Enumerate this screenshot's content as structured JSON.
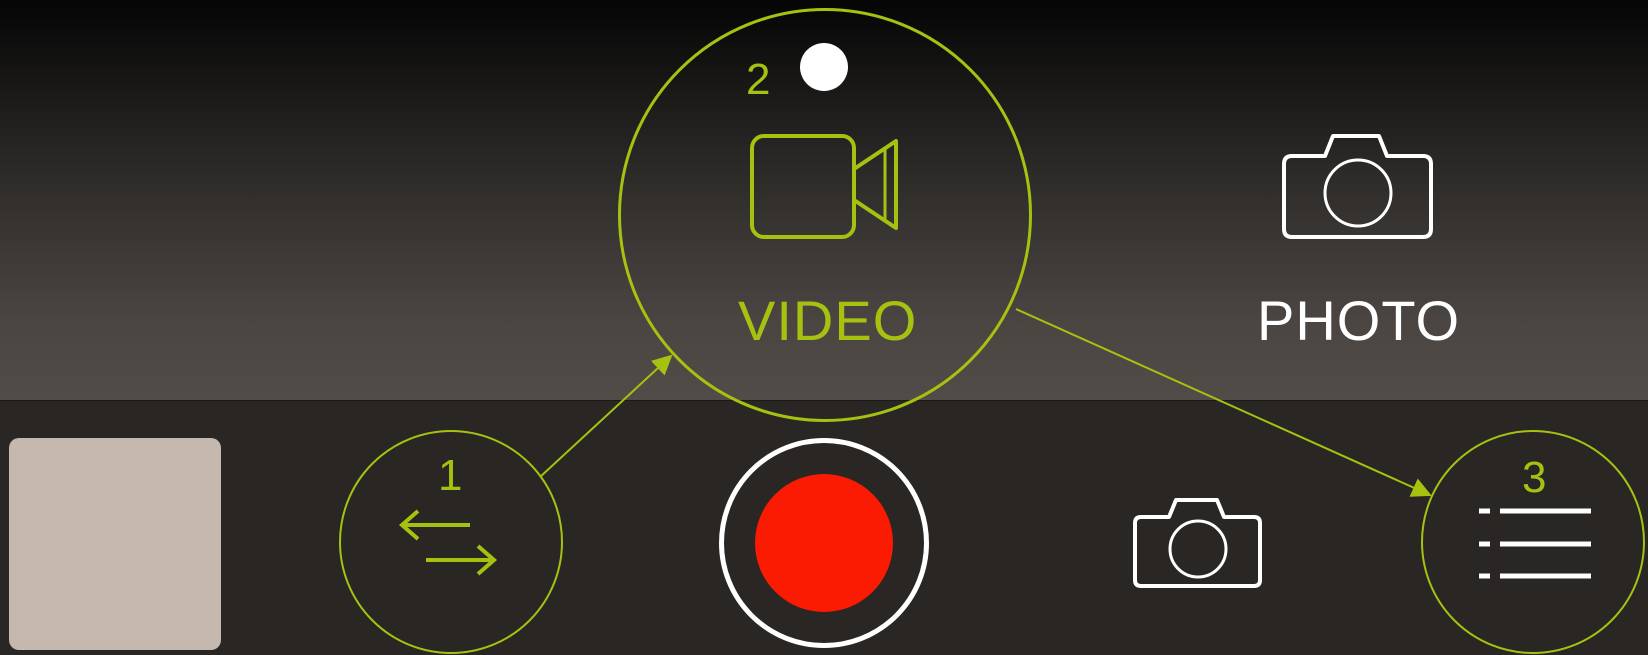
{
  "callouts": {
    "one": "1",
    "two": "2",
    "three": "3"
  },
  "modes": {
    "video_label": "VIDEO",
    "photo_label": "PHOTO",
    "active": "VIDEO"
  },
  "icons": {
    "switch": "swap-arrows-icon",
    "video": "video-camera-icon",
    "photo": "camera-icon",
    "menu": "list-icon",
    "record": "record-button",
    "recording_indicator": "dot-icon"
  },
  "colors": {
    "accent": "#a5c211",
    "record": "#fa1b02",
    "thumbnail": "#c5b8ae",
    "text": "#ffffff"
  }
}
